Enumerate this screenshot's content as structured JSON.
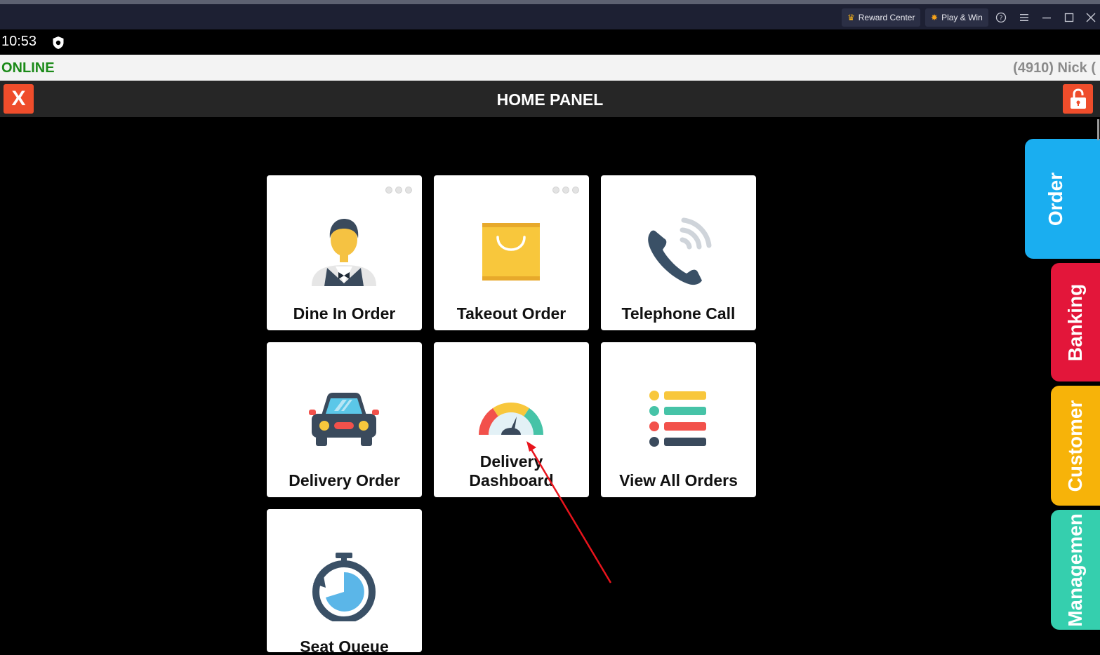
{
  "emulator": {
    "reward_center": "Reward Center",
    "play_win": "Play & Win"
  },
  "status_bar": {
    "time": "10:53"
  },
  "online_bar": {
    "status": "ONLINE",
    "user": "(4910) Nick ("
  },
  "header": {
    "title": "HOME PANEL",
    "close_label": "X"
  },
  "tiles": [
    {
      "label": "Dine In Order",
      "icon": "waiter-icon"
    },
    {
      "label": "Takeout Order",
      "icon": "shopping-bag-icon"
    },
    {
      "label": "Telephone Call",
      "icon": "telephone-icon"
    },
    {
      "label": "Delivery Order",
      "icon": "car-icon"
    },
    {
      "label": "Delivery Dashboard",
      "line1": "Delivery",
      "line2": "Dashboard",
      "icon": "speedometer-icon"
    },
    {
      "label": "View All Orders",
      "icon": "list-icon"
    },
    {
      "label": "Seat Queue",
      "icon": "stopwatch-icon"
    }
  ],
  "side_tabs": [
    {
      "label": "Order",
      "color": "#1aaef0"
    },
    {
      "label": "Banking",
      "color": "#e3163a"
    },
    {
      "label": "Customer",
      "color": "#f7b309"
    },
    {
      "label": "Managemen",
      "color": "#35cfae"
    }
  ],
  "colors": {
    "accent_red": "#ef4d2b",
    "online_green": "#1b8a18",
    "annotation_arrow": "#e8141c"
  }
}
